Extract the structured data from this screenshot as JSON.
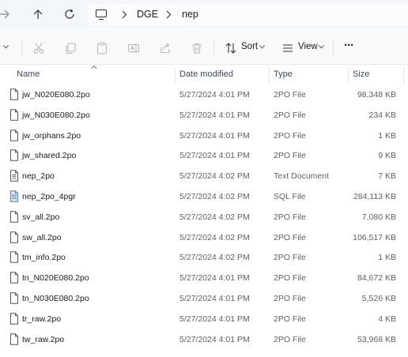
{
  "breadcrumb": {
    "items": [
      "DGE",
      "nep"
    ]
  },
  "toolbar": {
    "sort_label": "Sort",
    "view_label": "View",
    "more_label": "···"
  },
  "columns": {
    "name": "Name",
    "date": "Date modified",
    "type": "Type",
    "size": "Size"
  },
  "files": [
    {
      "name": "jw_N020E080.2po",
      "date": "5/27/2024 4:01 PM",
      "type": "2PO File",
      "size": "98,348 KB",
      "icon": "generic-file-icon"
    },
    {
      "name": "jw_N030E080.2po",
      "date": "5/27/2024 4:01 PM",
      "type": "2PO File",
      "size": "234 KB",
      "icon": "generic-file-icon"
    },
    {
      "name": "jw_orphans.2po",
      "date": "5/27/2024 4:01 PM",
      "type": "2PO File",
      "size": "1 KB",
      "icon": "generic-file-icon"
    },
    {
      "name": "jw_shared.2po",
      "date": "5/27/2024 4:01 PM",
      "type": "2PO File",
      "size": "9 KB",
      "icon": "generic-file-icon"
    },
    {
      "name": "nep_2po",
      "date": "5/27/2024 4:02 PM",
      "type": "Text Document",
      "size": "7 KB",
      "icon": "text-document-icon"
    },
    {
      "name": "nep_2po_4pgr",
      "date": "5/27/2024 4:02 PM",
      "type": "SQL File",
      "size": "284,113 KB",
      "icon": "sql-file-icon"
    },
    {
      "name": "sv_all.2po",
      "date": "5/27/2024 4:02 PM",
      "type": "2PO File",
      "size": "7,080 KB",
      "icon": "generic-file-icon"
    },
    {
      "name": "sw_all.2po",
      "date": "5/27/2024 4:02 PM",
      "type": "2PO File",
      "size": "106,517 KB",
      "icon": "generic-file-icon"
    },
    {
      "name": "tm_info.2po",
      "date": "5/27/2024 4:02 PM",
      "type": "2PO File",
      "size": "1 KB",
      "icon": "generic-file-icon"
    },
    {
      "name": "tn_N020E080.2po",
      "date": "5/27/2024 4:01 PM",
      "type": "2PO File",
      "size": "84,672 KB",
      "icon": "generic-file-icon"
    },
    {
      "name": "tn_N030E080.2po",
      "date": "5/27/2024 4:01 PM",
      "type": "2PO File",
      "size": "5,526 KB",
      "icon": "generic-file-icon"
    },
    {
      "name": "tr_raw.2po",
      "date": "5/27/2024 4:01 PM",
      "type": "2PO File",
      "size": "4 KB",
      "icon": "generic-file-icon"
    },
    {
      "name": "tw_raw.2po",
      "date": "5/27/2024 4:01 PM",
      "type": "2PO File",
      "size": "53,968 KB",
      "icon": "generic-file-icon"
    }
  ],
  "colors": {
    "address_bar_bg": "#f3f6fb",
    "toolbar_bg": "#f9f9f9",
    "header_text": "#3b4a5c",
    "secondary_text": "#5f5f5f",
    "disabled_icon": "#b8b8b8",
    "sql_icon_blue": "#4a7fc1"
  }
}
